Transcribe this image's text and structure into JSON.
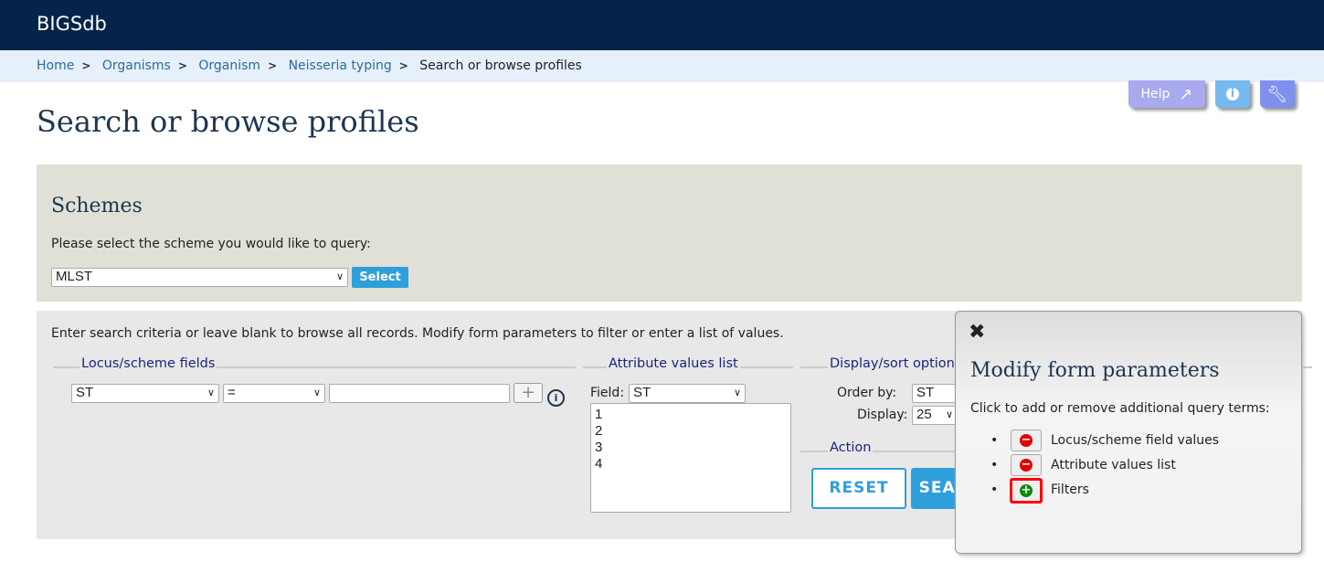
{
  "header": {
    "title": "BIGSdb"
  },
  "breadcrumb": {
    "items": [
      "Home",
      "Organisms",
      "Organism",
      "Neisseria typing"
    ],
    "current": "Search or browse profiles"
  },
  "toolbar": {
    "help_label": "Help"
  },
  "page": {
    "title": "Search or browse profiles"
  },
  "schemes": {
    "heading": "Schemes",
    "prompt": "Please select the scheme you would like to query:",
    "selected": "MLST",
    "select_label": "Select"
  },
  "search": {
    "intro": "Enter search criteria or leave blank to browse all records. Modify form parameters to filter or enter a list of values.",
    "locus_legend": "Locus/scheme fields",
    "locus_field": "ST",
    "operator": "=",
    "value": "",
    "attr_legend": "Attribute values list",
    "field_label": "Field:",
    "field_value": "ST",
    "list_values": "1\n2\n3\n4",
    "display_legend": "Display/sort options",
    "order_label": "Order by:",
    "order_value": "ST",
    "display_label": "Display:",
    "display_value": "25",
    "action_legend": "Action",
    "reset_label": "RESET",
    "search_label": "SEARCH"
  },
  "modify_panel": {
    "title": "Modify form parameters",
    "instructions": "Click to add or remove additional query terms:",
    "items": [
      {
        "label": "Locus/scheme field values",
        "state": "remove"
      },
      {
        "label": "Attribute values list",
        "state": "remove"
      },
      {
        "label": "Filters",
        "state": "add"
      }
    ]
  },
  "colors": {
    "header": "#05244a",
    "accent": "#2f9fdc",
    "remove": "#e00000",
    "add": "#0a8a0a",
    "highlight": "#ff0000"
  }
}
